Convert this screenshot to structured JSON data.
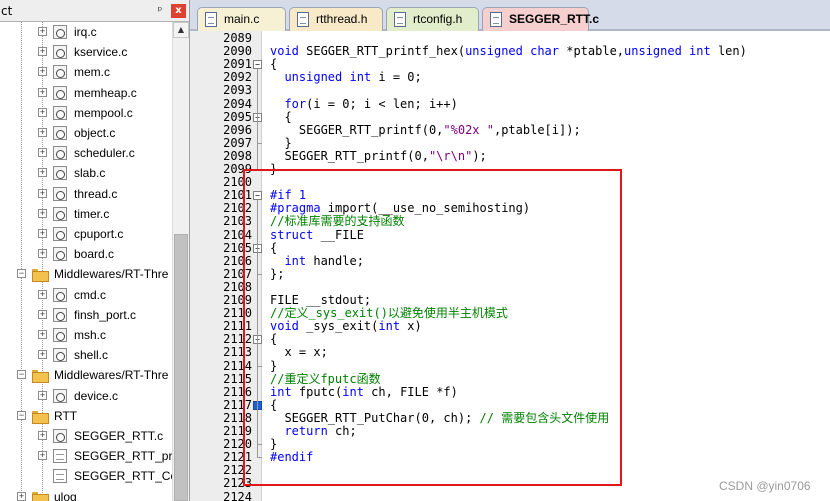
{
  "left_panel": {
    "title": "ct",
    "pin_glyph": "ᵖ",
    "close_glyph": "x",
    "tree": [
      {
        "label": "irq.c",
        "icon": "c-file-icon",
        "expander": "+"
      },
      {
        "label": "kservice.c",
        "icon": "c-file-icon",
        "expander": "+"
      },
      {
        "label": "mem.c",
        "icon": "c-file-icon",
        "expander": "+"
      },
      {
        "label": "memheap.c",
        "icon": "c-file-icon",
        "expander": "+"
      },
      {
        "label": "mempool.c",
        "icon": "c-file-icon",
        "expander": "+"
      },
      {
        "label": "object.c",
        "icon": "c-file-icon",
        "expander": "+"
      },
      {
        "label": "scheduler.c",
        "icon": "c-file-icon",
        "expander": "+"
      },
      {
        "label": "slab.c",
        "icon": "c-file-icon",
        "expander": "+"
      },
      {
        "label": "thread.c",
        "icon": "c-file-icon",
        "expander": "+"
      },
      {
        "label": "timer.c",
        "icon": "c-file-icon",
        "expander": "+"
      },
      {
        "label": "cpuport.c",
        "icon": "c-file-icon",
        "expander": "+"
      },
      {
        "label": "board.c",
        "icon": "c-file-icon",
        "expander": "+"
      },
      {
        "label": "Middlewares/RT-Thre",
        "icon": "folder-icon",
        "expander": "-"
      },
      {
        "label": "cmd.c",
        "icon": "c-file-icon",
        "expander": "+"
      },
      {
        "label": "finsh_port.c",
        "icon": "c-file-icon",
        "expander": "+"
      },
      {
        "label": "msh.c",
        "icon": "c-file-icon",
        "expander": "+"
      },
      {
        "label": "shell.c",
        "icon": "c-file-icon",
        "expander": "+"
      },
      {
        "label": "Middlewares/RT-Thre",
        "icon": "folder-icon",
        "expander": "-"
      },
      {
        "label": "device.c",
        "icon": "c-file-icon",
        "expander": "+"
      },
      {
        "label": "RTT",
        "icon": "folder-icon",
        "expander": "-"
      },
      {
        "label": "SEGGER_RTT.c",
        "icon": "c-file-icon",
        "expander": "+"
      },
      {
        "label": "SEGGER_RTT_print",
        "icon": "file-icon",
        "expander": "+"
      },
      {
        "label": "SEGGER_RTT_Conf",
        "icon": "file-icon",
        "expander": ""
      },
      {
        "label": "ulog",
        "icon": "folder-icon",
        "expander": "+"
      }
    ]
  },
  "editor": {
    "tabs": [
      {
        "label": "main.c",
        "color": "#f6f1d4",
        "active": false
      },
      {
        "label": "rtthread.h",
        "color": "#f8eac8",
        "active": false
      },
      {
        "label": "rtconfig.h",
        "color": "#e2eecb",
        "active": false
      },
      {
        "label": "SEGGER_RTT.c",
        "color": "#f6cfcf",
        "active": true
      }
    ],
    "line_numbers": [
      "2089",
      "2090",
      "2091",
      "2092",
      "2093",
      "2094",
      "2095",
      "2096",
      "2097",
      "2098",
      "2099",
      "2100",
      "2101",
      "2102",
      "2103",
      "2104",
      "2105",
      "2106",
      "2107",
      "2108",
      "2109",
      "2110",
      "2111",
      "2112",
      "2113",
      "2114",
      "2115",
      "2116",
      "2117",
      "2118",
      "2119",
      "2120",
      "2121",
      "2122",
      "2123",
      "2124"
    ],
    "code_lines": [
      [],
      [
        {
          "t": "void ",
          "c": "kw"
        },
        {
          "t": "SEGGER_RTT_printf_hex(",
          "c": ""
        },
        {
          "t": "unsigned char",
          "c": "kw"
        },
        {
          "t": " *ptable,",
          "c": ""
        },
        {
          "t": "unsigned int",
          "c": "kw"
        },
        {
          "t": " len)",
          "c": ""
        }
      ],
      [
        {
          "t": "{",
          "c": ""
        }
      ],
      [
        {
          "t": "  unsigned int",
          "c": "kw"
        },
        {
          "t": " i = 0;",
          "c": ""
        }
      ],
      [],
      [
        {
          "t": "  for",
          "c": "kw"
        },
        {
          "t": "(i = 0; i < len; i++)",
          "c": ""
        }
      ],
      [
        {
          "t": "  {",
          "c": ""
        }
      ],
      [
        {
          "t": "    SEGGER_RTT_printf(0,",
          "c": ""
        },
        {
          "t": "\"%02x \"",
          "c": "st"
        },
        {
          "t": ",ptable[i]);",
          "c": ""
        }
      ],
      [
        {
          "t": "  }",
          "c": ""
        }
      ],
      [
        {
          "t": "  SEGGER_RTT_printf(0,",
          "c": ""
        },
        {
          "t": "\"\\r\\n\"",
          "c": "st"
        },
        {
          "t": ");",
          "c": ""
        }
      ],
      [
        {
          "t": "}",
          "c": ""
        }
      ],
      [],
      [
        {
          "t": "#if 1",
          "c": "pp"
        }
      ],
      [
        {
          "t": "#pragma",
          "c": "pp"
        },
        {
          "t": " import(__use_no_semihosting)",
          "c": ""
        }
      ],
      [
        {
          "t": "//标准库需要的支持函数",
          "c": "cm"
        }
      ],
      [
        {
          "t": "struct",
          "c": "kw"
        },
        {
          "t": " __FILE",
          "c": ""
        }
      ],
      [
        {
          "t": "{",
          "c": ""
        }
      ],
      [
        {
          "t": "  int",
          "c": "kw"
        },
        {
          "t": " handle;",
          "c": ""
        }
      ],
      [
        {
          "t": "};",
          "c": ""
        }
      ],
      [],
      [
        {
          "t": "FILE __stdout;",
          "c": ""
        }
      ],
      [
        {
          "t": "//定义_sys_exit()以避免使用半主机模式",
          "c": "cm"
        }
      ],
      [
        {
          "t": "void",
          "c": "kw"
        },
        {
          "t": " _sys_exit(",
          "c": ""
        },
        {
          "t": "int",
          "c": "kw"
        },
        {
          "t": " x)",
          "c": ""
        }
      ],
      [
        {
          "t": "{",
          "c": ""
        }
      ],
      [
        {
          "t": "  x = x;",
          "c": ""
        }
      ],
      [
        {
          "t": "}",
          "c": ""
        }
      ],
      [
        {
          "t": "//重定义fputc函数",
          "c": "cm"
        }
      ],
      [
        {
          "t": "int",
          "c": "kw"
        },
        {
          "t": " fputc(",
          "c": ""
        },
        {
          "t": "int",
          "c": "kw"
        },
        {
          "t": " ch, FILE *f)",
          "c": ""
        }
      ],
      [
        {
          "t": "{",
          "c": ""
        }
      ],
      [
        {
          "t": "  SEGGER_RTT_PutChar(0, ch); ",
          "c": ""
        },
        {
          "t": "// 需要包含头文件使用",
          "c": "cm"
        }
      ],
      [
        {
          "t": "  return",
          "c": "kw"
        },
        {
          "t": " ch;",
          "c": ""
        }
      ],
      [
        {
          "t": "}",
          "c": ""
        }
      ],
      [
        {
          "t": "#endif",
          "c": "pp"
        }
      ],
      [],
      [],
      []
    ],
    "fold_markers": {
      "2091": "-",
      "2095": "-",
      "2101": "-",
      "2105": "-",
      "2112": "-",
      "2117": "-"
    },
    "active_fold_lines": [
      "2117",
      "2120"
    ]
  },
  "watermark": "CSDN @yin0706",
  "colors": {
    "keyword": "#0000ff",
    "comment": "#008000",
    "string": "#800080",
    "highlight_box": "#e01818"
  }
}
